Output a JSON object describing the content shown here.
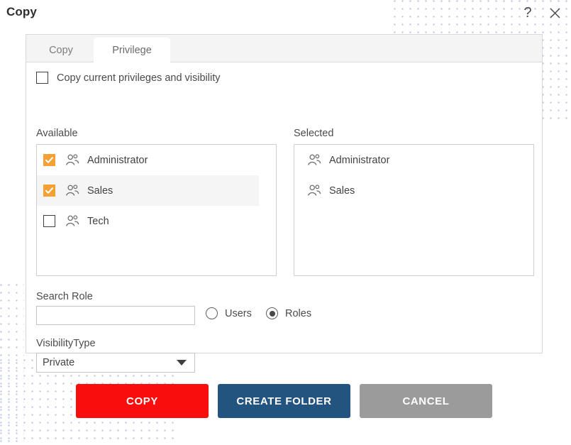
{
  "window": {
    "title": "Copy",
    "help_icon": "question-mark-icon",
    "close_icon": "close-icon"
  },
  "tabs": [
    {
      "label": "Copy",
      "active": false
    },
    {
      "label": "Privilege",
      "active": true
    }
  ],
  "privilege_tab": {
    "copy_current": {
      "label": "Copy current privileges and visibility",
      "checked": false
    },
    "available": {
      "heading": "Available",
      "items": [
        {
          "label": "Administrator",
          "checked": true,
          "highlighted": false,
          "icon": "people-group-icon"
        },
        {
          "label": "Sales",
          "checked": true,
          "highlighted": true,
          "icon": "people-group-icon"
        },
        {
          "label": "Tech",
          "checked": false,
          "highlighted": false,
          "icon": "people-group-icon"
        }
      ]
    },
    "selected": {
      "heading": "Selected",
      "items": [
        {
          "label": "Administrator",
          "icon": "people-group-icon"
        },
        {
          "label": "Sales",
          "icon": "people-group-icon"
        }
      ]
    },
    "search_role": {
      "label": "Search Role",
      "value": "",
      "placeholder": ""
    },
    "scope_radios": [
      {
        "label": "Users",
        "selected": false
      },
      {
        "label": "Roles",
        "selected": true
      }
    ],
    "visibility": {
      "label": "VisibilityType",
      "value": "Private",
      "caret_icon": "chevron-down-icon"
    }
  },
  "actions": [
    {
      "label": "COPY",
      "color": "#f90d0d"
    },
    {
      "label": "CREATE FOLDER",
      "color": "#23537f"
    },
    {
      "label": "CANCEL",
      "color": "#9b9b9b"
    }
  ],
  "colors": {
    "checkbox_checked": "#f5a033",
    "tab_bar": "#f4f4f4",
    "dot_pattern": "#b9bfe4"
  }
}
